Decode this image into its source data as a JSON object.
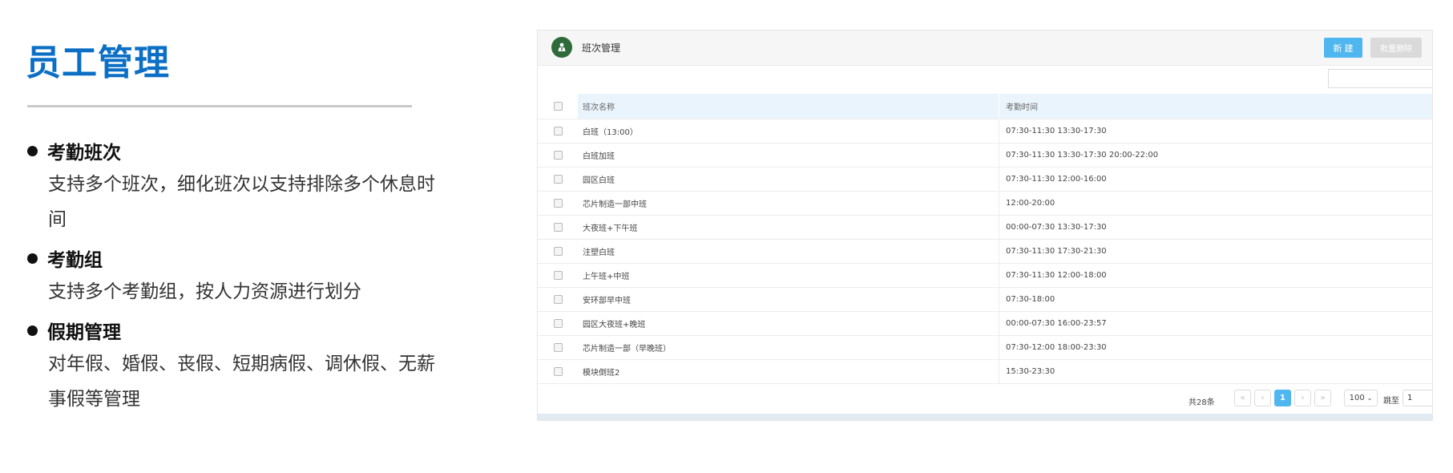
{
  "slide": {
    "title": "员工管理",
    "features": [
      {
        "heading": "考勤班次",
        "desc": [
          "支持多个班次，细化班次以支持排除多个休息时",
          "间"
        ]
      },
      {
        "heading": "考勤组",
        "desc": [
          "支持多个考勤组，按人力资源进行划分"
        ]
      },
      {
        "heading": "假期管理",
        "desc": [
          "对年假、婚假、丧假、短期病假、调休假、无薪",
          "事假等管理"
        ]
      }
    ]
  },
  "app": {
    "header_title": "班次管理",
    "new_label": "新 建",
    "batch_delete_label": "批量删除",
    "search_placeholder": "",
    "columns": {
      "name": "班次名称",
      "time": "考勤时间"
    },
    "rows": [
      {
        "name": "白班（13:00）",
        "time": "07:30-11:30 13:30-17:30"
      },
      {
        "name": "白班加班",
        "time": "07:30-11:30 13:30-17:30 20:00-22:00"
      },
      {
        "name": "园区白班",
        "time": "07:30-11:30 12:00-16:00"
      },
      {
        "name": "芯片制造一部中班",
        "time": "12:00-20:00"
      },
      {
        "name": "大夜班+下午班",
        "time": "00:00-07:30 13:30-17:30"
      },
      {
        "name": "注塑白班",
        "time": "07:30-11:30 17:30-21:30"
      },
      {
        "name": "上午班+中班",
        "time": "07:30-11:30 12:00-18:00"
      },
      {
        "name": "安环部早中班",
        "time": "07:30-18:00"
      },
      {
        "name": "园区大夜班+晚班",
        "time": "00:00-07:30 16:00-23:57"
      },
      {
        "name": "芯片制造一部（早晚班）",
        "time": "07:30-12:00 18:00-23:30"
      },
      {
        "name": "模块倒班2",
        "time": "15:30-23:30"
      }
    ],
    "pager": {
      "total": "共28条",
      "first": "«",
      "prev": "‹",
      "current_page": "1",
      "next": "›",
      "last": "»",
      "page_size": "100",
      "goto_label": "跳至",
      "goto_value": "1"
    },
    "colors": {
      "accent": "#4fb6ef",
      "title": "#0b6fc6",
      "icon_bg": "#2f6b3a"
    }
  }
}
